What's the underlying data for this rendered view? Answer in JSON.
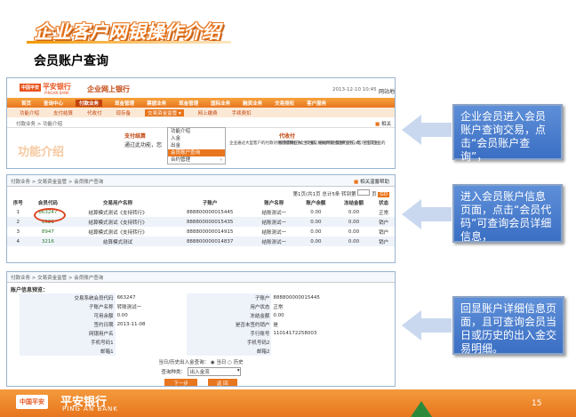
{
  "slide": {
    "title": "企业客户网银操作介绍",
    "subtitle": "会员账户查询",
    "page_number": "15"
  },
  "shot1": {
    "logo": "中国平安",
    "bank_cn": "平安银行",
    "bank_en": "PINGAN BANK",
    "product": "企业网上银行",
    "datetime": "2013-12-10  10:45",
    "top_right": "网站地",
    "nav1": [
      "首页",
      "查询中心",
      "付款业务",
      "现金管理",
      "票据业务",
      "现金管理",
      "国际业务",
      "融资业务",
      "交易授权",
      "客户服务"
    ],
    "nav2": [
      "功能介绍",
      "支付结算",
      "代收付",
      "现存备",
      "交易资金监管",
      "网上缴费",
      "手续费扣"
    ],
    "crumb": "付款业务 > 功能介绍",
    "dropdown": [
      "功能介绍",
      "入金",
      "出金",
      "会员账户查询",
      "合约管理"
    ],
    "dropdown_highlight": "会员账户查询",
    "body_left": "支付结算",
    "body_text": "通过此功能，您",
    "body_text2": "企业通过大型客户的付款对象的结算业务，资金交易清算支付结算业务，客户可向企业的",
    "body_right": "代收付",
    "body_right_text": "使用网银方式生下载，通过卡批量进行的方式，企业可批",
    "intro_text": "功能介绍",
    "help": "相关"
  },
  "shot2": {
    "crumb": "付款业务 > 交易资金监管 > 会员账户查询",
    "help": "相关温馨帮助",
    "pager": "第1页(共1页  总计5条  转到第",
    "pager_page": "页",
    "pager_go": "GO",
    "headers": [
      "序号",
      "会员代码",
      "交易用户名称",
      "子账户",
      "账户名称",
      "账户余额",
      "冻结金额",
      "状态"
    ],
    "rows": [
      [
        "1",
        "663247",
        "结算模式测试《支持转行》",
        "888800000015445",
        "结账测试一",
        "0.00",
        "0.00",
        "正常"
      ],
      [
        "2",
        "8521",
        "结算模式测试《支持转行》",
        "888800000015435",
        "结账测试一",
        "0.00",
        "0.00",
        "销户"
      ],
      [
        "3",
        "8947",
        "结算模式测试《支持转行》",
        "888800000014915",
        "结账测试一",
        "0.00",
        "0.00",
        "销户"
      ],
      [
        "4",
        "3216",
        "结算模式测试",
        "888800000014837",
        "结账测试一",
        "0.00",
        "0.00",
        "销户"
      ]
    ]
  },
  "shot3": {
    "crumb": "付款业务 > 交易资金监管 > 会员账户查询",
    "section": "账户信息预览：",
    "rows": [
      [
        "交易系统会员代码",
        "663247",
        "子账户",
        "888800000015445"
      ],
      [
        "子账户名称",
        "转账测试一",
        "用户状态",
        "正常"
      ],
      [
        "可用余额",
        "0.00",
        "冻结金额",
        "0.00"
      ],
      [
        "签约日期",
        "2013-11-08",
        "是否未签约销户",
        "是"
      ],
      [
        "网银用户名",
        "",
        "手行账号",
        "11014172258003"
      ],
      [
        "手机号码1",
        "",
        "手机号码2",
        ""
      ],
      [
        "邮箱1",
        "",
        "邮箱2",
        ""
      ]
    ],
    "query_label": "当日/历史出入金查询：",
    "opt_today": "当日",
    "opt_history": "历史",
    "type_label": "查询种类：",
    "type_value": "出入金流",
    "btn_next": "下一步",
    "btn_back": "返 回"
  },
  "callouts": {
    "c1": "企业会员进入会员账户查询交易，点击“会员账户查询”，",
    "c2": "进入会员账户信息页面，点击“会员代码”可查询会员详细信息，",
    "c3": "回显账户详细信息页面，且可查询会员当日或历史的出入金交易明细。"
  },
  "footer": {
    "logo": "中国平安",
    "bank_cn": "平安银行",
    "bank_en": "PING AN BANK"
  },
  "colors": {
    "accent": "#e8761e",
    "callout": "#3b6fc4",
    "link_code": "#2a7a2a"
  }
}
